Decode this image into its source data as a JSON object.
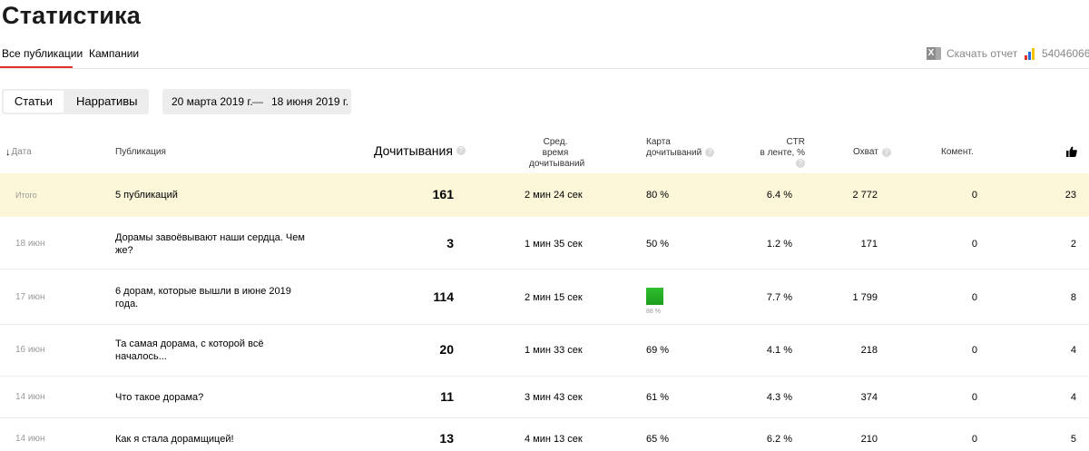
{
  "page": {
    "title": "Статистика"
  },
  "tabs": [
    {
      "label": "Все публикации",
      "active": true
    },
    {
      "label": "Кампании",
      "active": false
    }
  ],
  "toolbar": {
    "download_label": "Скачать отчет",
    "download_icon": "excel-icon",
    "metrika_icon": "metrika-icon",
    "metrika_id": "54046066"
  },
  "toggle": {
    "articles": "Статьи",
    "narratives": "Нарративы",
    "selected": "Статьи"
  },
  "daterange": {
    "from": "20 марта 2019 г.",
    "sep": "—",
    "to": "18 июня 2019 г."
  },
  "columns": {
    "date": "Дата",
    "publication": "Публикация",
    "reads": "Дочитывания",
    "avg_time_1": "Сред. время",
    "avg_time_2": "дочитываний",
    "map_1": "Карта",
    "map_2": "дочитываний",
    "ctr_1": "CTR",
    "ctr_2": "в ленте, %",
    "reach": "Охват",
    "comments": "Комент.",
    "likes_icon": "thumbs-up-icon",
    "help_glyph": "?"
  },
  "total": {
    "label": "Итого",
    "publication": "5 публикаций",
    "reads": "161",
    "time": "2 мин 24 сек",
    "map": "80 %",
    "ctr": "6.4 %",
    "reach": "2 772",
    "comments": "0",
    "likes": "23"
  },
  "rows": [
    {
      "date": "18 июн",
      "publication": "Дорамы завоёвывают наши сердца. Чем же?",
      "reads": "3",
      "time": "1 мин 35 сек",
      "map": "50 %",
      "ctr": "1.2 %",
      "reach": "171",
      "comments": "0",
      "likes": "2"
    },
    {
      "date": "17 июн",
      "publication": "6 дорам, которые вышли в июне 2019 года.",
      "reads": "114",
      "time": "2 мин 15 сек",
      "map": "88 %",
      "map_color": "#22b022",
      "ctr": "7.7 %",
      "reach": "1 799",
      "comments": "0",
      "likes": "8"
    },
    {
      "date": "16 июн",
      "publication": "Та самая дорама, с которой всё началось...",
      "reads": "20",
      "time": "1 мин 33 сек",
      "map": "69 %",
      "ctr": "4.1 %",
      "reach": "218",
      "comments": "0",
      "likes": "4"
    },
    {
      "date": "14 июн",
      "publication": "Что такое дорама?",
      "reads": "11",
      "time": "3 мин 43 сек",
      "map": "61 %",
      "ctr": "4.3 %",
      "reach": "374",
      "comments": "0",
      "likes": "4"
    },
    {
      "date": "14 июн",
      "publication": "Как я стала дорамщицей!",
      "reads": "13",
      "time": "4 мин 13 сек",
      "map": "65 %",
      "ctr": "6.2 %",
      "reach": "210",
      "comments": "0",
      "likes": "5"
    }
  ]
}
